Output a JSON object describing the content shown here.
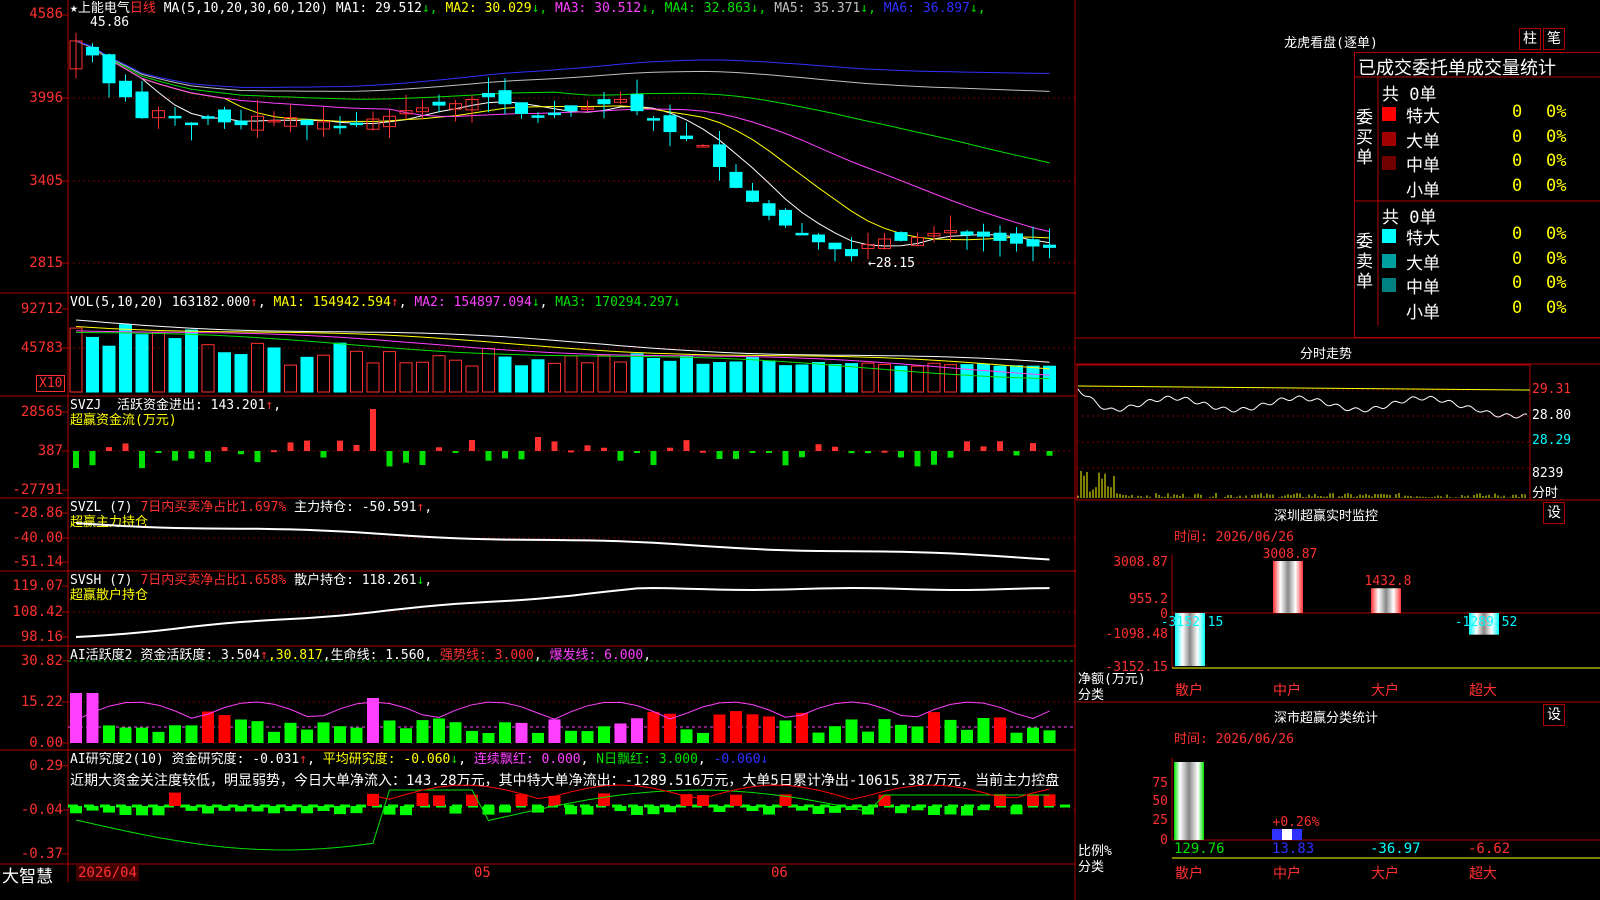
{
  "brand": "大智慧",
  "stock": {
    "name": "上能电气",
    "star": "★",
    "period": "日线",
    "ma_label": "MA(5,10,20,30,60,120)",
    "ma": [
      {
        "label": "MA1: 29.512",
        "arrow": "↓",
        "color": "#ffffff"
      },
      {
        "label": "MA2: 30.029",
        "arrow": "↓",
        "color": "#ffff00"
      },
      {
        "label": "MA3: 30.512",
        "arrow": "↓",
        "color": "#ff40ff"
      },
      {
        "label": "MA4: 32.863",
        "arrow": "↓",
        "color": "#00e000"
      },
      {
        "label": "MA5: 35.371",
        "arrow": "↓",
        "color": "#c0c0c0"
      },
      {
        "label": "MA6: 36.897",
        "arrow": "↓",
        "color": "#3030ff"
      }
    ],
    "high_mark": "45.86",
    "low_mark": "←28.15"
  },
  "price_axis": [
    "4586",
    "3996",
    "3405",
    "2815"
  ],
  "vol": {
    "label": "VOL(5,10,20)",
    "value": "163182.000",
    "arrow": "↑",
    "ma1": "MA1: 154942.594",
    "ma1_arrow": "↑",
    "ma2": "MA2: 154897.094",
    "ma2_arrow": "↓",
    "ma3": "MA3: 170294.297",
    "ma3_arrow": "↓",
    "axis": [
      "92712",
      "45783"
    ],
    "unit": "X10"
  },
  "svzj": {
    "label": "SVZJ",
    "t1": "活跃资金进出: 143.201",
    "arrow": "↑",
    "comma": ",",
    "sub": "超赢资金流(万元)",
    "axis": [
      "28565",
      "387",
      "-27791"
    ]
  },
  "svzl": {
    "label": "SVZL (7)",
    "t1": "7日内买卖净占比1.697%",
    "t2": "主力持仓: -50.591",
    "arrow": "↑",
    "comma": ",",
    "sub": "超赢主力持仓",
    "axis": [
      "-28.86",
      "-40.00",
      "-51.14"
    ]
  },
  "svsh": {
    "label": "SVSH (7)",
    "t1": "7日内买卖净占比1.658%",
    "t2": "散户持仓: 118.261",
    "arrow": "↓",
    "comma": ",",
    "sub": "超赢散户持仓",
    "axis": [
      "119.07",
      "108.42",
      "98.16"
    ]
  },
  "ai1": {
    "label": "AI活跃度2",
    "t1": "资金活跃度: 3.504",
    "a1": "↑",
    "t2": "30.817",
    "c1": ",",
    "t3": "生命线: 1.560",
    "c2": ",",
    "t4": "强势线: 3.000",
    "t5": "爆发线: 6.000",
    "c3": ",",
    "axis": [
      "30.82",
      "15.22",
      "0.00"
    ]
  },
  "ai2": {
    "label": "AI研究度2(10)",
    "t1": "资金研究度: -0.031",
    "a1": "↑",
    "t2": "平均研究度: -0.060",
    "a2": "↓",
    "t3": "连续飘红: 0.000",
    "t4": "N日飘红: 3.000",
    "t5": "-0.060",
    "a3": "↓",
    "comment": "近期大资金关注度较低，明显弱势，今日大单净流入：143.28万元，其中特大单净流出：-1289.516万元，大单5日累计净出-10615.387万元，当前主力控盘",
    "axis": [
      "0.29",
      "-0.04",
      "-0.37"
    ]
  },
  "date_axis": [
    "2026/04",
    "05",
    "06"
  ],
  "right": {
    "dragon_title": "龙虎看盘(逐单)",
    "btn1": "柱",
    "btn2": "笔",
    "stat_title": "已成交委托单成交量统计",
    "buy_label": "委买单",
    "sell_label": "委卖单",
    "buy_total": "共 0单",
    "sell_total": "共 0单",
    "buy_rows": [
      {
        "name": "特大",
        "n": "0",
        "p": "0%",
        "color": "#ff0000"
      },
      {
        "name": "大单",
        "n": "0",
        "p": "0%",
        "color": "#a00000"
      },
      {
        "name": "中单",
        "n": "0",
        "p": "0%",
        "color": "#700000"
      },
      {
        "name": "小单",
        "n": "0",
        "p": "0%",
        "color": ""
      }
    ],
    "sell_rows": [
      {
        "name": "特大",
        "n": "0",
        "p": "0%",
        "color": "#00ffff"
      },
      {
        "name": "大单",
        "n": "0",
        "p": "0%",
        "color": "#00a0a0"
      },
      {
        "name": "中单",
        "n": "0",
        "p": "0%",
        "color": "#008080"
      },
      {
        "name": "小单",
        "n": "0",
        "p": "0%",
        "color": ""
      }
    ],
    "intraday_title": "分时走势",
    "intraday_axis": [
      "29.31",
      "28.80",
      "28.29",
      "8239",
      "分时"
    ],
    "sz_title": "深圳超赢实时监控",
    "sz_time": "时间: 2026/06/26",
    "sz_btn": "设",
    "sz_axis": [
      "3008.87",
      "955.2",
      "0",
      "-1098.48",
      "-3152.15"
    ],
    "sz_ylabel": "净额(万元)",
    "sz_xlabel": "分类",
    "sz_bars": [
      {
        "cat": "散户",
        "value": "-3152.15",
        "v": -3152.15
      },
      {
        "cat": "中户",
        "value": "3008.87",
        "v": 3008.87
      },
      {
        "cat": "大户",
        "value": "1432.8",
        "v": 1432.8
      },
      {
        "cat": "超大",
        "value": "-1289.52",
        "v": -1289.52
      }
    ],
    "sc_title": "深市超赢分类统计",
    "sc_time": "时间: 2026/06/26",
    "sc_btn": "设",
    "sc_axis": [
      "75",
      "50",
      "25",
      "0"
    ],
    "sc_ylabel": "比例%",
    "sc_xlabel": "分类",
    "sc_bar_label": "+0.26%",
    "sc_values": [
      {
        "cat": "散户",
        "value": "129.76",
        "color": "#00e000"
      },
      {
        "cat": "中户",
        "value": "13.83",
        "color": "#3030ff"
      },
      {
        "cat": "大户",
        "value": "-36.97",
        "color": "#00ffff"
      },
      {
        "cat": "超大",
        "value": "-6.62",
        "color": "#ff3030"
      }
    ]
  }
}
